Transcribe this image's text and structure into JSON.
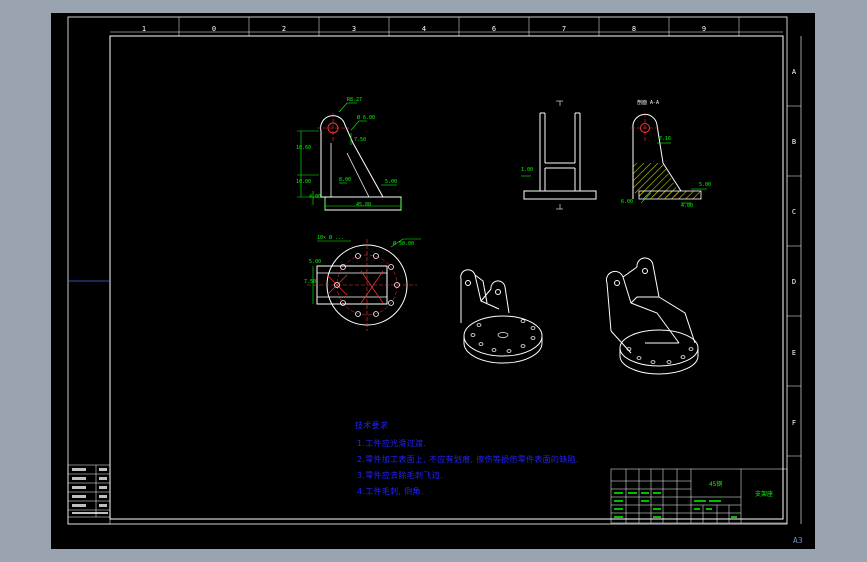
{
  "frame": {
    "column_markers": [
      "1",
      "0",
      "2",
      "3",
      "4",
      "6",
      "7",
      "8",
      "9"
    ],
    "row_markers": [
      "A",
      "B",
      "C",
      "D",
      "E",
      "F"
    ],
    "sheet_size": "A3"
  },
  "views": {
    "front": {
      "dimensions": [
        "R8.27",
        "Ø 6.00",
        "7.50",
        "10.60",
        "10.00",
        "8.00",
        "5.00",
        "4.00",
        "45.00"
      ]
    },
    "side": {
      "dimensions": [
        "1.00"
      ]
    },
    "section": {
      "label": "剖面 A-A",
      "dimensions": [
        "7.16",
        "5.00",
        "6.00",
        "4.00"
      ]
    },
    "top": {
      "dimensions": [
        "10× Ø ...",
        "Ø 50.00",
        "5.00",
        "7.50"
      ]
    }
  },
  "technical_requirements": {
    "title": "技术要求",
    "items": [
      "1.工件应光滑过渡.",
      "2.零件加工表面上, 不应有划痕, 擦伤等损伤零件表面的缺陷.",
      "3.零件应去除毛刺飞边.",
      "4.工件毛刺, 倒角."
    ]
  },
  "title_block": {
    "material": "45钢",
    "part_name": "支架座"
  },
  "colors": {
    "background": "#000000",
    "outline": "#ffffff",
    "dimension": "#00ff00",
    "center_line": "#ff3333",
    "note_text": "#2222ff",
    "hatch": "#c8c800"
  }
}
